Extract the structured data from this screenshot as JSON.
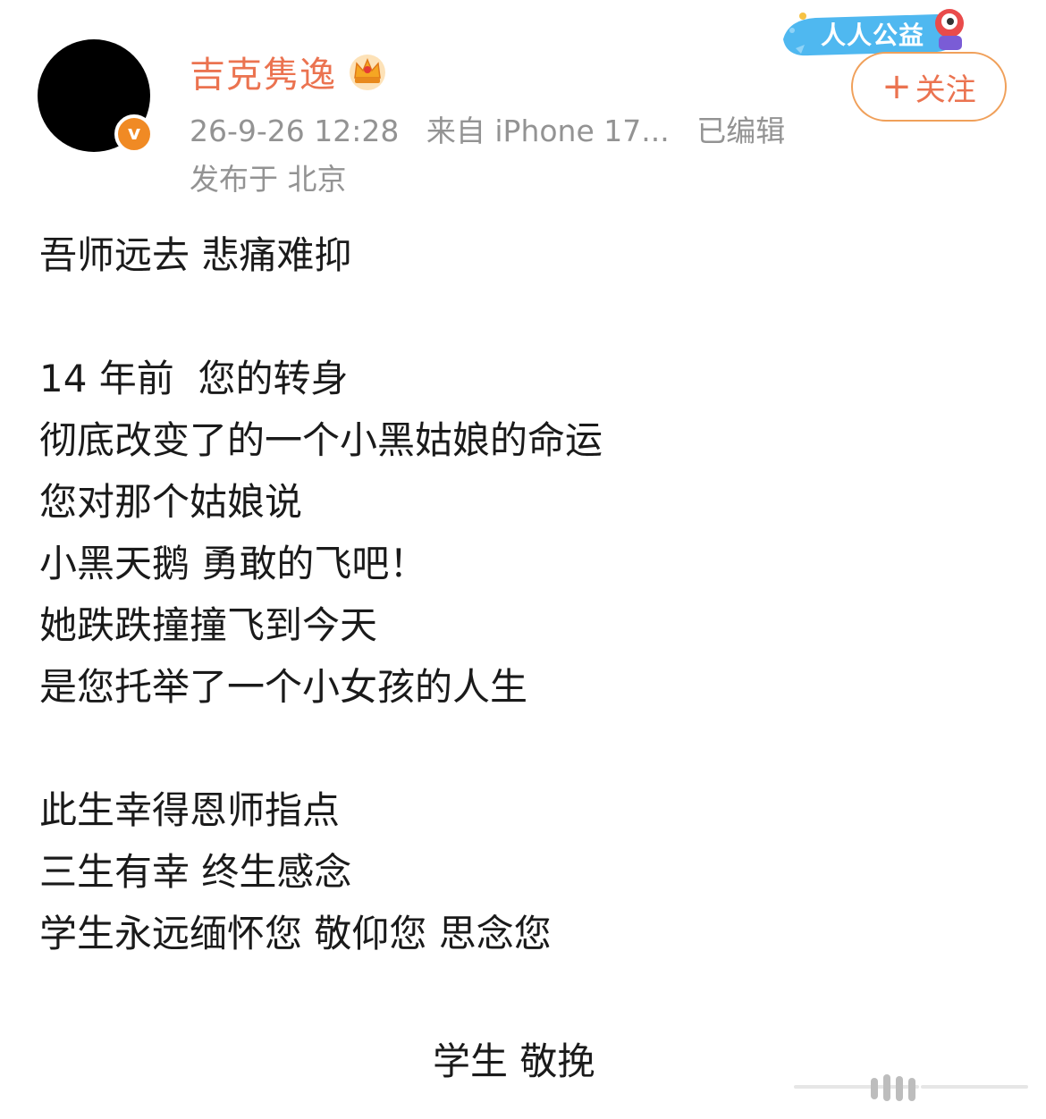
{
  "author": {
    "name": "吉克隽逸",
    "verified_badge": "v",
    "verified_color": "#f08a24",
    "name_color": "#eb7350",
    "crown_icon": "crown-icon"
  },
  "meta": {
    "timestamp": "26-9-26 12:28",
    "source": "来自 iPhone 17...",
    "edited": "已编辑",
    "location": "发布于 北京"
  },
  "promo_banner": {
    "label": "人人公益",
    "icon": "mascot-icon"
  },
  "follow_button": {
    "plus": "+",
    "label": "关注",
    "color": "#eb7350"
  },
  "post": {
    "lines": [
      "吾师远去 悲痛难抑",
      "",
      "14 年前  您的转身",
      "彻底改变了的一个小黑姑娘的命运",
      "您对那个姑娘说",
      "小黑天鹅 勇敢的飞吧！",
      "她跌跌撞撞飞到今天",
      "是您托举了一个小女孩的人生",
      "",
      "此生幸得恩师指点",
      "三生有幸 终生感念",
      "学生永远缅怀您 敬仰您 思念您"
    ],
    "signature": "学生 敬挽"
  }
}
